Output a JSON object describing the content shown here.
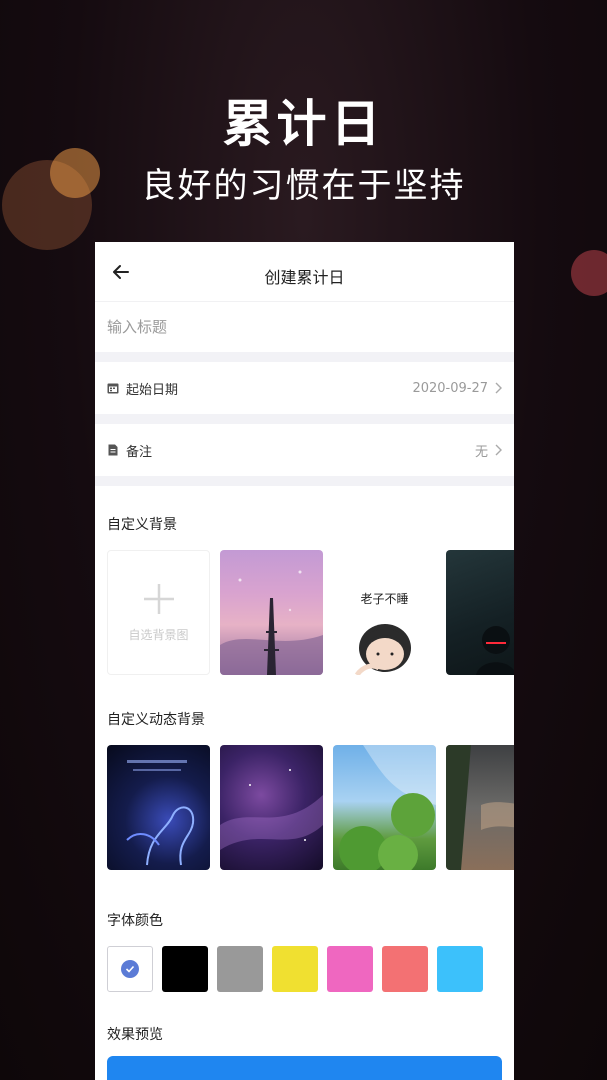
{
  "hero": {
    "title": "累计日",
    "subtitle": "良好的习惯在于坚持"
  },
  "navbar": {
    "title": "创建累计日",
    "back_icon": "arrow-left-icon"
  },
  "title_input": {
    "placeholder": "输入标题",
    "value": ""
  },
  "start_date": {
    "label": "起始日期",
    "value": "2020-09-27",
    "icon": "calendar-icon"
  },
  "note": {
    "label": "备注",
    "value": "无",
    "icon": "document-icon"
  },
  "custom_background": {
    "title": "自定义背景",
    "add_label": "自选背景图",
    "images": [
      {
        "name": "eiffel-tower-pink-sky"
      },
      {
        "name": "cartoon-boy-sleeping",
        "caption": "老子不睡"
      },
      {
        "name": "dark-portrait-red-eyes"
      }
    ]
  },
  "dynamic_background": {
    "title": "自定义动态背景",
    "images": [
      {
        "name": "neon-boy-night"
      },
      {
        "name": "purple-galaxy"
      },
      {
        "name": "tree-blue-sky"
      },
      {
        "name": "dusk-road"
      }
    ]
  },
  "font_color": {
    "title": "字体颜色",
    "selected_index": 0,
    "colors": [
      "#ffffff",
      "#000000",
      "#999999",
      "#f0e030",
      "#ef67c0",
      "#f37173",
      "#3cc1fb"
    ]
  },
  "preview": {
    "title": "效果预览",
    "accent": "#1f86f0"
  }
}
